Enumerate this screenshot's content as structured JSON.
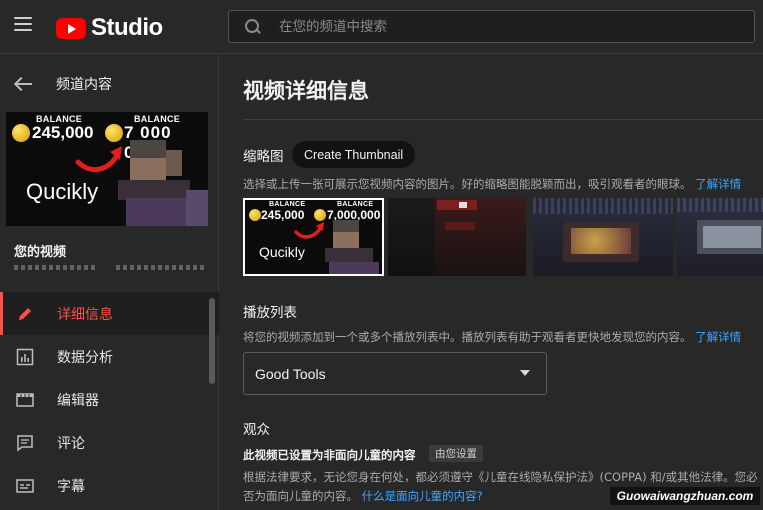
{
  "header": {
    "logo_text": "Studio",
    "search_placeholder": "在您的频道中搜索"
  },
  "sidebar": {
    "back_label": "频道内容",
    "thumbnail": {
      "balance_label_1": "BALANCE",
      "balance_value_1": "245,000",
      "balance_label_2": "BALANCE",
      "balance_value_2": "7 000 000",
      "overlay_text": "Qucikly"
    },
    "your_video_label": "您的视频",
    "nav_items": [
      {
        "label": "详细信息",
        "icon": "pencil-icon",
        "active": true
      },
      {
        "label": "数据分析",
        "icon": "bar-chart-icon",
        "active": false
      },
      {
        "label": "编辑器",
        "icon": "film-editor-icon",
        "active": false
      },
      {
        "label": "评论",
        "icon": "comment-icon",
        "active": false
      },
      {
        "label": "字幕",
        "icon": "subtitles-icon",
        "active": false
      }
    ]
  },
  "main": {
    "title": "视频详细信息",
    "thumbnail_section": {
      "title": "缩略图",
      "create_button": "Create Thumbnail",
      "description": "选择或上传一张可展示您视频内容的图片。好的缩略图能脱颖而出，吸引观看者的眼球。",
      "learn_more": "了解详情",
      "selected_thumb": {
        "balance_label_1": "BALANCE",
        "balance_value_1": "245,000",
        "balance_label_2": "BALANCE",
        "balance_value_2": "7,000,000",
        "overlay_text": "Qucikly"
      }
    },
    "playlist_section": {
      "title": "播放列表",
      "description": "将您的视频添加到一个或多个播放列表中。播放列表有助于观看者更快地发现您的内容。",
      "learn_more": "了解详情",
      "selected_value": "Good Tools"
    },
    "audience_section": {
      "title": "观众",
      "subtitle": "此视频已设置为非面向儿童的内容",
      "tag": "由您设置",
      "line1": "根据法律要求，无论您身在何处，都必须遵守《儿童在线隐私保护法》(COPPA) 和/或其他法律。您必",
      "line2_prefix": "否为面向儿童的内容。",
      "line2_link": "什么是面向儿童的内容?"
    }
  },
  "watermark": "Guowaiwangzhuan.com",
  "colors": {
    "background": "#282828",
    "accent_red": "#ff4e45",
    "link_blue": "#3ea6ff",
    "logo_red": "#ff0000"
  }
}
